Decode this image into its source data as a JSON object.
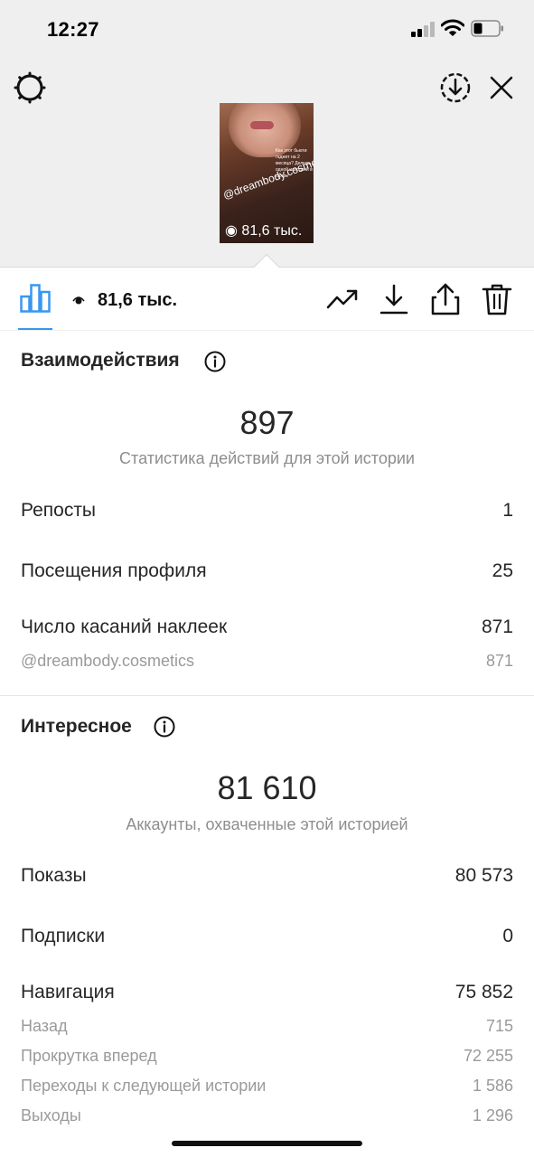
{
  "status_bar": {
    "time": "12:27"
  },
  "story": {
    "handle_overlay": "@dreambody.cosmetics",
    "sticker_text": "Как этот бьюти гаджет на 2 месяца? Делюсь одной находкой в салон",
    "views_overlay": "81,6 тыс."
  },
  "toolbar": {
    "reach_label": "81,6 тыс."
  },
  "interactions": {
    "title": "Взаимодействия",
    "total": "897",
    "caption": "Статистика действий для этой истории",
    "rows": [
      {
        "label": "Репосты",
        "value": "1"
      },
      {
        "label": "Посещения профиля",
        "value": "25"
      },
      {
        "label": "Число касаний наклеек",
        "value": "871"
      }
    ],
    "sub_rows": [
      {
        "label": "@dreambody.cosmetics",
        "value": "871"
      }
    ]
  },
  "discovery": {
    "title": "Интересное",
    "total": "81 610",
    "caption": "Аккаунты, охваченные этой историей",
    "rows": [
      {
        "label": "Показы",
        "value": "80 573"
      },
      {
        "label": "Подписки",
        "value": "0"
      },
      {
        "label": "Навигация",
        "value": "75 852"
      }
    ],
    "sub_rows": [
      {
        "label": "Назад",
        "value": "715"
      },
      {
        "label": "Прокрутка вперед",
        "value": "72 255"
      },
      {
        "label": "Переходы к следующей истории",
        "value": "1 586"
      },
      {
        "label": "Выходы",
        "value": "1 296"
      }
    ]
  },
  "icons": {
    "settings": "gear-icon",
    "download_story": "download-circle-icon",
    "close": "close-icon",
    "insights_tab": "bar-chart-icon",
    "views": "eye-icon",
    "promote": "trending-up-icon",
    "save": "download-icon",
    "share": "share-icon",
    "delete": "trash-icon",
    "info": "info-icon"
  },
  "colors": {
    "accent": "#3897f0",
    "secondary_text": "#8e8e8e",
    "top_background": "#efefef"
  }
}
